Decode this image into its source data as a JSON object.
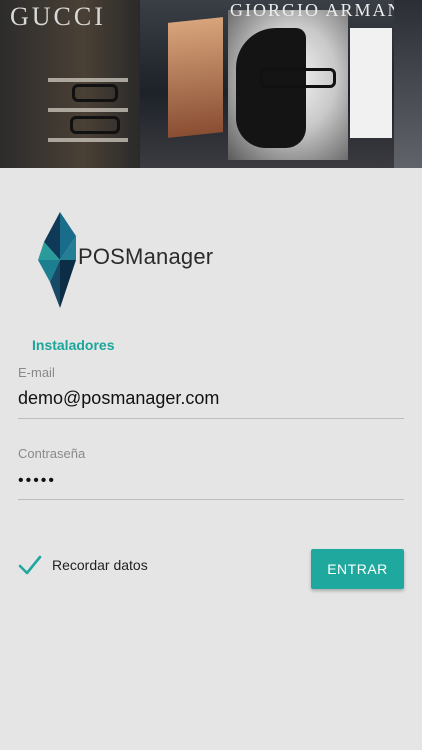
{
  "hero": {
    "brand_text": "GUCCI",
    "poster_text": "GIORGIO ARMANI"
  },
  "logo": {
    "wordmark": "POSManager",
    "colors": [
      "#0f3a57",
      "#1a6d8a",
      "#2a9a9a",
      "#0c2d45"
    ]
  },
  "login": {
    "section_title": "Instaladores",
    "email": {
      "label": "E-mail",
      "value": "demo@posmanager.com"
    },
    "password": {
      "label": "Contraseña",
      "value": "•••••"
    },
    "remember": {
      "label": "Recordar datos",
      "checked": true
    },
    "submit_label": "ENTRAR"
  },
  "colors": {
    "accent": "#1fa89d",
    "background": "#e5e5e5"
  }
}
